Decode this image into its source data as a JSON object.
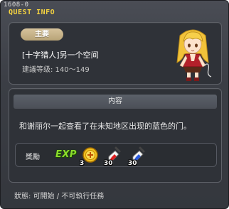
{
  "header": {
    "code": "1608-0",
    "title": "QUEST INFO"
  },
  "quest": {
    "badge": "主要",
    "name": "[十字猎人]另一个空间",
    "level": "建議等级: 140～149"
  },
  "content": {
    "section_title": "内容",
    "description": "和谢丽尔一起查看了在未知地区出现的蓝色的门。"
  },
  "rewards": {
    "label": "獎勵",
    "exp_label": "EXP",
    "items": [
      {
        "icon": "gold-coin-icon",
        "qty": "3"
      },
      {
        "icon": "red-potion-icon",
        "qty": "30"
      },
      {
        "icon": "blue-potion-icon",
        "qty": "30"
      }
    ]
  },
  "status": "狀態: 可開始 / 不可執行任務",
  "colors": {
    "title": "#f4d240",
    "exp": "#8bdc2b",
    "badge": "#c9b389"
  }
}
